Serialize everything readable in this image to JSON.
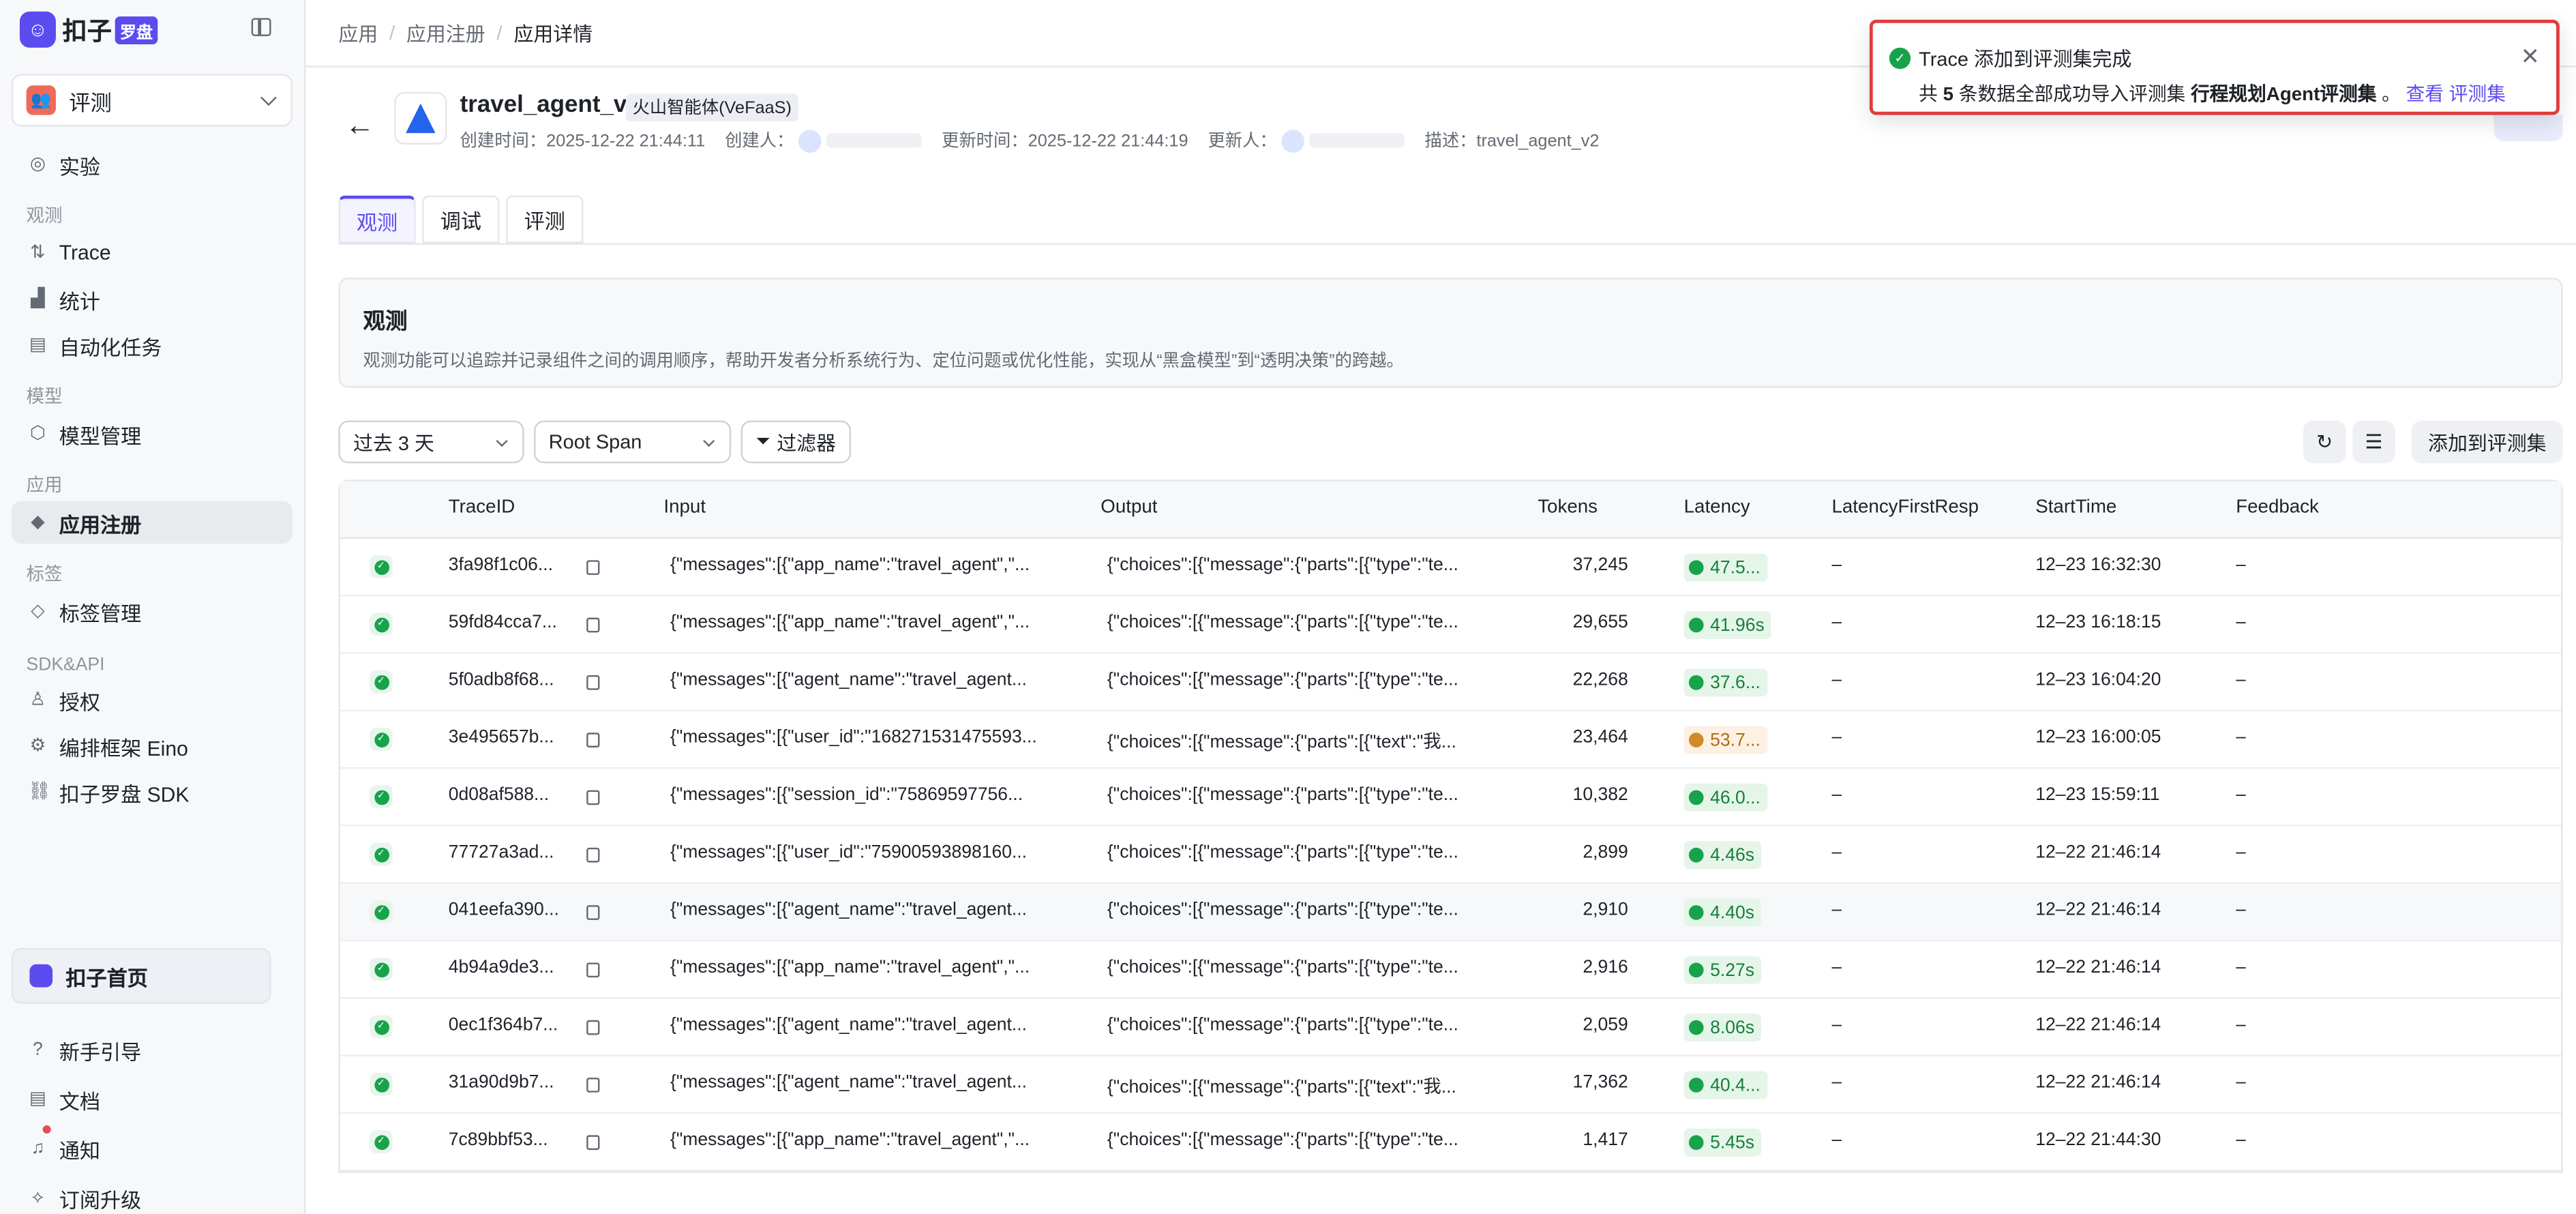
{
  "brand": {
    "name": "扣子",
    "badge": "罗盘"
  },
  "workspace": {
    "label": "评测"
  },
  "sidebar": {
    "top": [
      {
        "label": "实验",
        "icon": "experiment-icon"
      }
    ],
    "sections": [
      {
        "title": "观测",
        "items": [
          {
            "label": "Trace",
            "icon": "trace-icon"
          },
          {
            "label": "统计",
            "icon": "chart-icon"
          },
          {
            "label": "自动化任务",
            "icon": "task-icon"
          }
        ]
      },
      {
        "title": "模型",
        "items": [
          {
            "label": "模型管理",
            "icon": "model-icon"
          }
        ]
      },
      {
        "title": "应用",
        "items": [
          {
            "label": "应用注册",
            "icon": "cube-icon",
            "active": true
          }
        ]
      },
      {
        "title": "标签",
        "items": [
          {
            "label": "标签管理",
            "icon": "tag-icon"
          }
        ]
      },
      {
        "title": "SDK&API",
        "items": [
          {
            "label": "授权",
            "icon": "auth-icon"
          },
          {
            "label": "编排框架 Eino",
            "icon": "gear-icon"
          },
          {
            "label": "扣子罗盘 SDK",
            "icon": "link-icon"
          }
        ]
      }
    ],
    "home": "扣子首页",
    "bottom": [
      {
        "label": "新手引导",
        "icon": "help-icon"
      },
      {
        "label": "文档",
        "icon": "doc-icon"
      },
      {
        "label": "通知",
        "icon": "bell-icon"
      },
      {
        "label": "订阅升级",
        "icon": "upgrade-icon"
      }
    ]
  },
  "breadcrumb": [
    "应用",
    "应用注册",
    "应用详情"
  ],
  "app": {
    "name": "travel_agent_v2",
    "tag": "火山智能体(VeFaaS)",
    "created_label": "创建时间：",
    "created": "2025-12-22 21:44:11",
    "creator_label": "创建人：",
    "updated_label": "更新时间：",
    "updated": "2025-12-22 21:44:19",
    "updater_label": "更新人：",
    "desc_label": "描述：",
    "desc": "travel_agent_v2"
  },
  "tabs": [
    "观测",
    "调试",
    "评测"
  ],
  "intro": {
    "title": "观测",
    "desc": "观测功能可以追踪并记录组件之间的调用顺序，帮助开发者分析系统行为、定位问题或优化性能，实现从“黑盒模型”到“透明决策”的跨越。"
  },
  "filters": {
    "time": "过去 3 天",
    "span": "Root Span",
    "filter_btn": "过滤器"
  },
  "actions": {
    "add": "添加到评测集"
  },
  "table": {
    "headers": [
      "TraceID",
      "Input",
      "Output",
      "Tokens",
      "Latency",
      "LatencyFirstResp",
      "StartTime",
      "Feedback"
    ],
    "rows": [
      {
        "id": "3fa98f1c06...",
        "input": "{\"messages\":[{\"app_name\":\"travel_agent\",\"...",
        "output": "{\"choices\":[{\"message\":{\"parts\":[{\"type\":\"te...",
        "tokens": "37,245",
        "latency": "47.5...",
        "warn": false,
        "lfr": "–",
        "start": "12–23 16:32:30",
        "fb": "–"
      },
      {
        "id": "59fd84cca7...",
        "input": "{\"messages\":[{\"app_name\":\"travel_agent\",\"...",
        "output": "{\"choices\":[{\"message\":{\"parts\":[{\"type\":\"te...",
        "tokens": "29,655",
        "latency": "41.96s",
        "warn": false,
        "lfr": "–",
        "start": "12–23 16:18:15",
        "fb": "–"
      },
      {
        "id": "5f0adb8f68...",
        "input": "{\"messages\":[{\"agent_name\":\"travel_agent...",
        "output": "{\"choices\":[{\"message\":{\"parts\":[{\"type\":\"te...",
        "tokens": "22,268",
        "latency": "37.6...",
        "warn": false,
        "lfr": "–",
        "start": "12–23 16:04:20",
        "fb": "–"
      },
      {
        "id": "3e495657b...",
        "input": "{\"messages\":[{\"user_id\":\"168271531475593...",
        "output": "{\"choices\":[{\"message\":{\"parts\":[{\"text\":\"我...",
        "tokens": "23,464",
        "latency": "53.7...",
        "warn": true,
        "lfr": "–",
        "start": "12–23 16:00:05",
        "fb": "–"
      },
      {
        "id": "0d08af588...",
        "input": "{\"messages\":[{\"session_id\":\"75869597756...",
        "output": "{\"choices\":[{\"message\":{\"parts\":[{\"type\":\"te...",
        "tokens": "10,382",
        "latency": "46.0...",
        "warn": false,
        "lfr": "–",
        "start": "12–23 15:59:11",
        "fb": "–"
      },
      {
        "id": "77727a3ad...",
        "input": "{\"messages\":[{\"user_id\":\"75900593898160...",
        "output": "{\"choices\":[{\"message\":{\"parts\":[{\"type\":\"te...",
        "tokens": "2,899",
        "latency": "4.46s",
        "warn": false,
        "lfr": "–",
        "start": "12–22 21:46:14",
        "fb": "–"
      },
      {
        "id": "041eefa390...",
        "input": "{\"messages\":[{\"agent_name\":\"travel_agent...",
        "output": "{\"choices\":[{\"message\":{\"parts\":[{\"type\":\"te...",
        "tokens": "2,910",
        "latency": "4.40s",
        "warn": false,
        "lfr": "–",
        "start": "12–22 21:46:14",
        "fb": "–",
        "hl": true
      },
      {
        "id": "4b94a9de3...",
        "input": "{\"messages\":[{\"app_name\":\"travel_agent\",\"...",
        "output": "{\"choices\":[{\"message\":{\"parts\":[{\"type\":\"te...",
        "tokens": "2,916",
        "latency": "5.27s",
        "warn": false,
        "lfr": "–",
        "start": "12–22 21:46:14",
        "fb": "–"
      },
      {
        "id": "0ec1f364b7...",
        "input": "{\"messages\":[{\"agent_name\":\"travel_agent...",
        "output": "{\"choices\":[{\"message\":{\"parts\":[{\"type\":\"te...",
        "tokens": "2,059",
        "latency": "8.06s",
        "warn": false,
        "lfr": "–",
        "start": "12–22 21:46:14",
        "fb": "–"
      },
      {
        "id": "31a90d9b7...",
        "input": "{\"messages\":[{\"agent_name\":\"travel_agent...",
        "output": "{\"choices\":[{\"message\":{\"parts\":[{\"text\":\"我...",
        "tokens": "17,362",
        "latency": "40.4...",
        "warn": false,
        "lfr": "–",
        "start": "12–22 21:46:14",
        "fb": "–"
      },
      {
        "id": "7c89bbf53...",
        "input": "{\"messages\":[{\"app_name\":\"travel_agent\",\"...",
        "output": "{\"choices\":[{\"message\":{\"parts\":[{\"type\":\"te...",
        "tokens": "1,417",
        "latency": "5.45s",
        "warn": false,
        "lfr": "–",
        "start": "12–22 21:44:30",
        "fb": "–"
      }
    ]
  },
  "toast": {
    "title": "Trace 添加到评测集完成",
    "prefix": "共",
    "count": "5",
    "middle": "条数据全部成功导入评测集",
    "dataset": "行程规划Agent评测集",
    "suffix": "。",
    "link1": "查看",
    "link2": "评测集"
  },
  "colors": {
    "accent": "#5b4cf0",
    "success": "#17a34a",
    "warn": "#d08a2a",
    "toast_border": "#e03c3c"
  }
}
